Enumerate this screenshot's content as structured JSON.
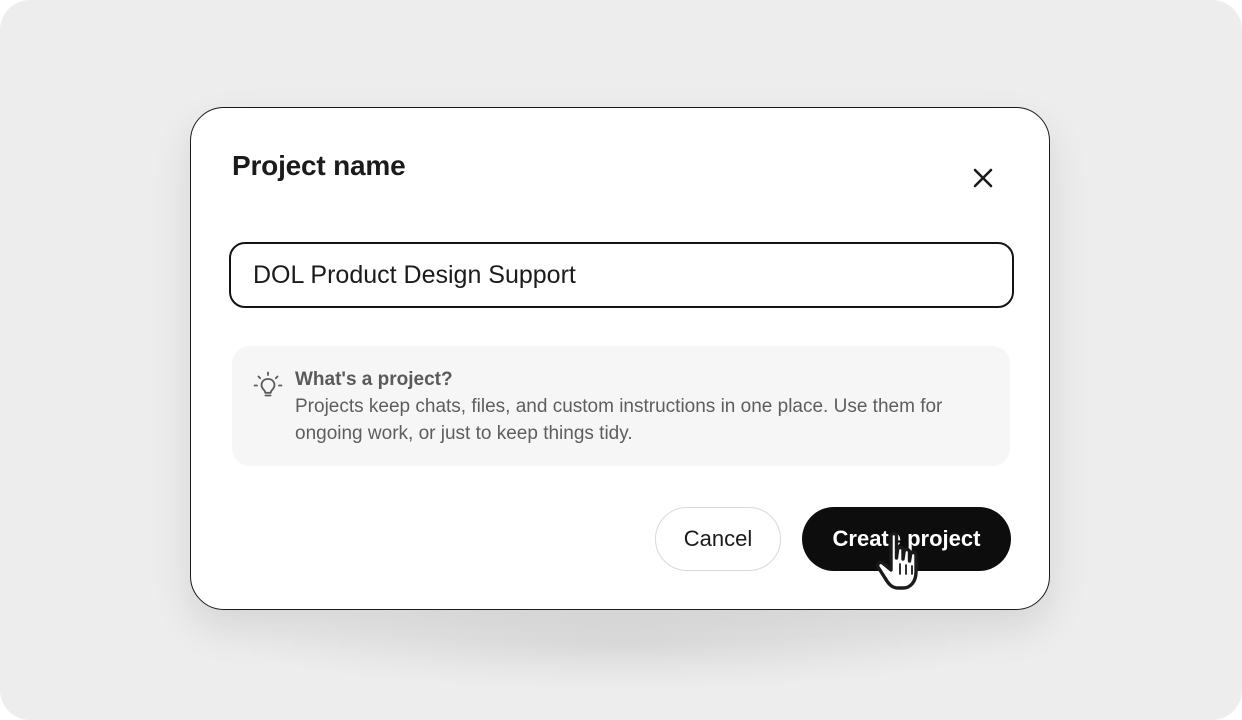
{
  "dialog": {
    "title": "Project name",
    "close_icon": "close-icon",
    "name_input": {
      "value": "DOL Product Design Support",
      "placeholder": ""
    },
    "info": {
      "icon": "lightbulb-icon",
      "heading": "What's a project?",
      "body": "Projects keep chats, files, and custom instructions in one place. Use them for ongoing work, or just to keep things tidy."
    },
    "buttons": {
      "cancel_label": "Cancel",
      "create_label": "Create project"
    }
  },
  "cursor": {
    "icon": "hand-pointer-icon"
  },
  "colors": {
    "backdrop": "#ededed",
    "primary_button": "#0d0d0d",
    "info_box": "#f6f6f6"
  }
}
